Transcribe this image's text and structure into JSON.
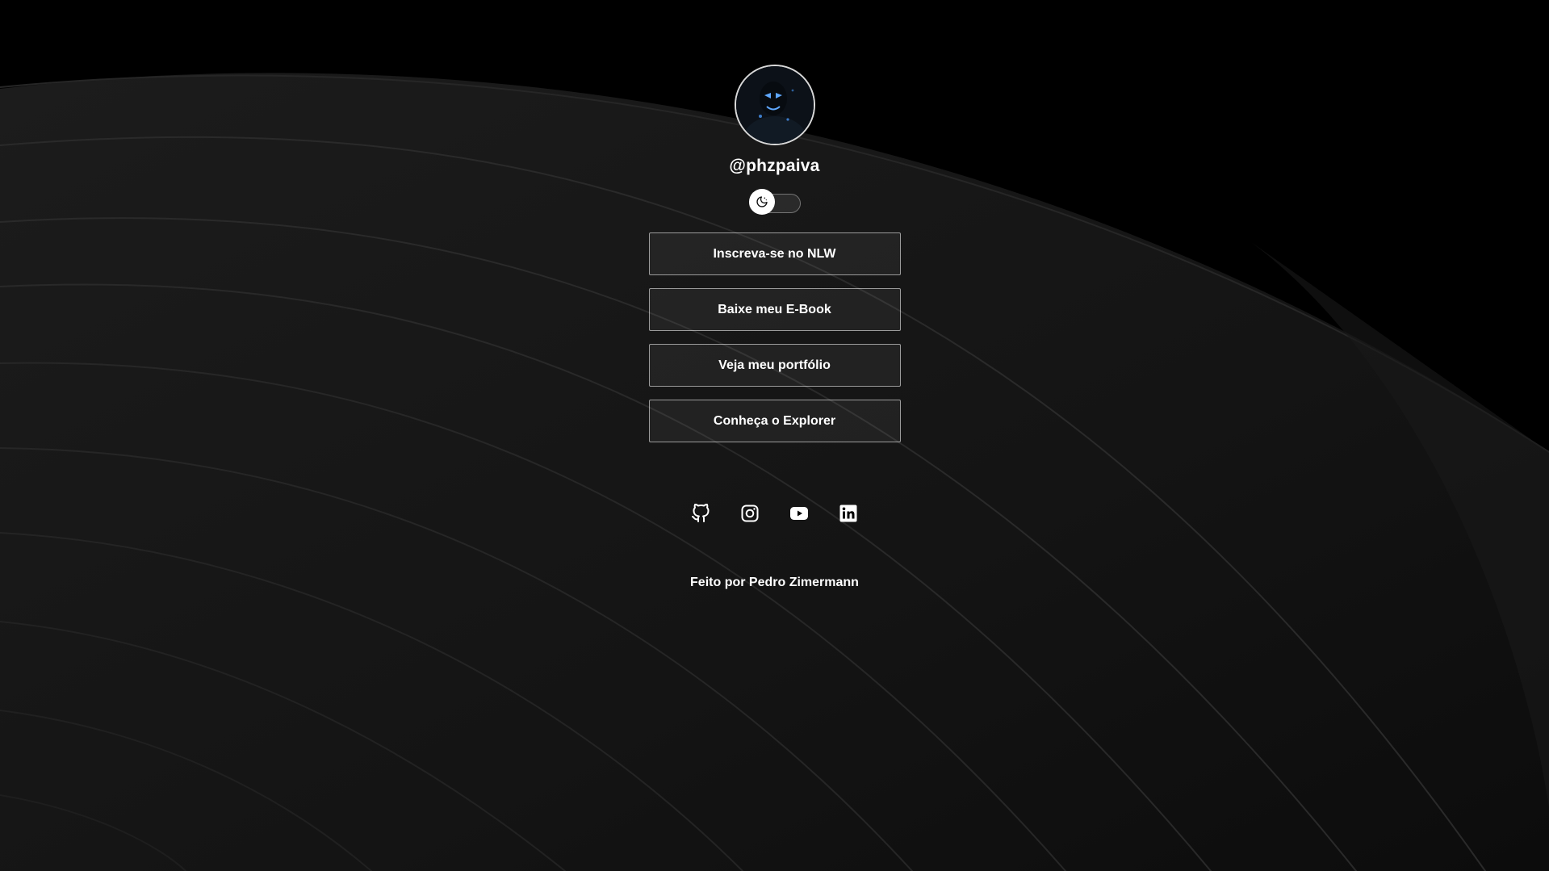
{
  "profile": {
    "username": "@phzpaiva"
  },
  "theme_switch": {
    "icon": "moon-icon",
    "state": "dark"
  },
  "links": [
    {
      "label": "Inscreva-se no NLW"
    },
    {
      "label": "Baixe meu E-Book"
    },
    {
      "label": "Veja meu portfólio"
    },
    {
      "label": "Conheça o Explorer"
    }
  ],
  "social": [
    {
      "icon": "github-icon"
    },
    {
      "icon": "instagram-icon"
    },
    {
      "icon": "youtube-icon"
    },
    {
      "icon": "linkedin-icon"
    }
  ],
  "footer": {
    "text": "Feito por Pedro Zimermann"
  },
  "colors": {
    "background": "#000000",
    "text": "#ffffff",
    "button_border": "#8c8c8c"
  }
}
